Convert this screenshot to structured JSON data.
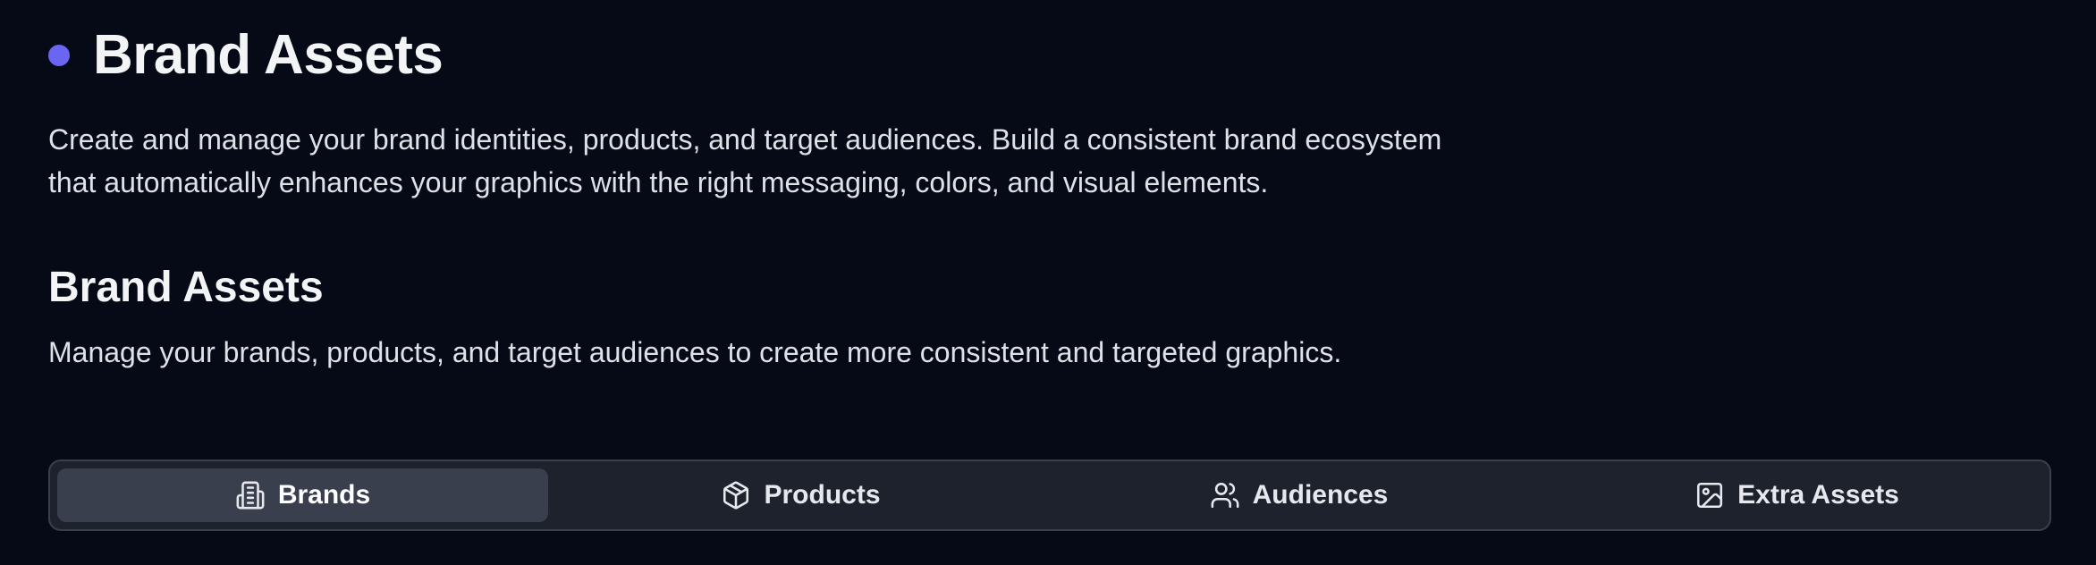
{
  "header": {
    "title": "Brand Assets",
    "accent_color": "#6b66f2",
    "description": "Create and manage your brand identities, products, and target audiences. Build a consistent brand ecosystem that automatically enhances your graphics with the right messaging, colors, and visual elements."
  },
  "section": {
    "title": "Brand Assets",
    "description": "Manage your brands, products, and target audiences to create more consistent and targeted graphics."
  },
  "tabs": [
    {
      "label": "Brands",
      "icon": "building-icon",
      "active": true
    },
    {
      "label": "Products",
      "icon": "package-icon",
      "active": false
    },
    {
      "label": "Audiences",
      "icon": "users-icon",
      "active": false
    },
    {
      "label": "Extra Assets",
      "icon": "image-icon",
      "active": false
    }
  ]
}
